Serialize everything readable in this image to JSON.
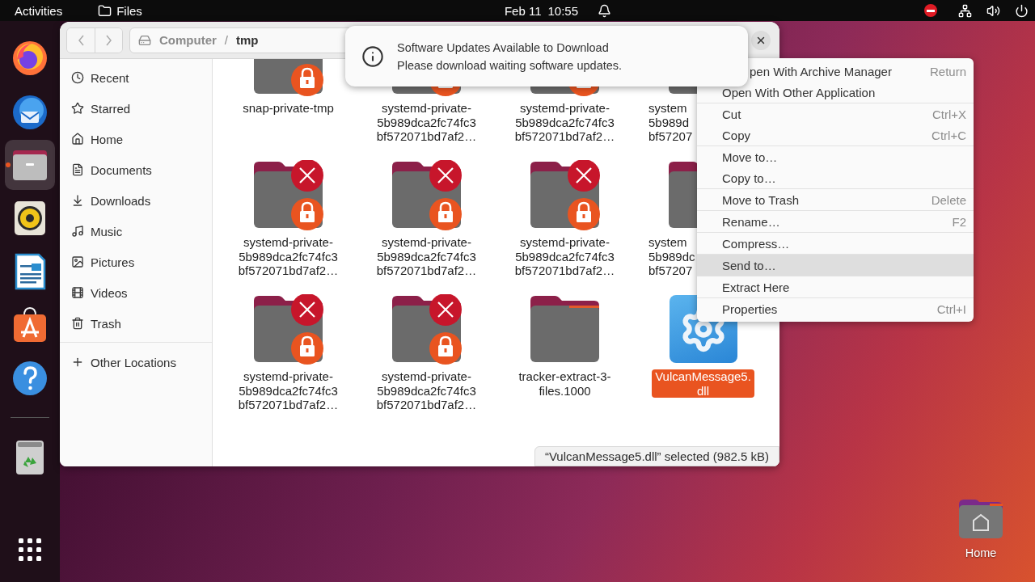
{
  "top_bar": {
    "activities": "Activities",
    "app_name": "Files",
    "date": "Feb 11",
    "time": "10:55"
  },
  "dock": {
    "apps": [
      {
        "kind": "firefox",
        "running": false
      },
      {
        "kind": "thunderbird",
        "running": false
      },
      {
        "kind": "files",
        "running": true
      },
      {
        "kind": "rhythmbox",
        "running": false
      },
      {
        "kind": "writer",
        "running": false
      },
      {
        "kind": "app-center",
        "running": false
      },
      {
        "kind": "help",
        "running": false
      }
    ]
  },
  "files_window": {
    "path": [
      {
        "label": "Computer",
        "current": false
      },
      {
        "label": "tmp",
        "current": true
      }
    ],
    "path_separator": "/",
    "sidebar": [
      {
        "label": "Recent",
        "selected": false
      },
      {
        "label": "Starred",
        "selected": false
      },
      {
        "label": "Home",
        "selected": false
      },
      {
        "label": "Documents",
        "selected": false
      },
      {
        "label": "Downloads",
        "selected": false
      },
      {
        "label": "Music",
        "selected": false
      },
      {
        "label": "Pictures",
        "selected": false
      },
      {
        "label": "Videos",
        "selected": false
      },
      {
        "label": "Trash",
        "selected": false
      }
    ],
    "other_locations": "Other Locations",
    "items": [
      {
        "kind": "folder",
        "lines": [
          "snap-private-tmp"
        ],
        "locked": true,
        "no_access": false,
        "cut_off": false,
        "selected": false
      },
      {
        "kind": "folder",
        "lines": [
          "systemd-private-",
          "5b989dca2fc74fc3",
          "bf572071bd7af2…"
        ],
        "locked": true,
        "cut_off": false,
        "selected": false
      },
      {
        "kind": "folder",
        "lines": [
          "systemd-private-",
          "5b989dca2fc74fc3",
          "bf572071bd7af2…"
        ],
        "locked": true,
        "cut_off": false,
        "selected": false
      },
      {
        "kind": "folder",
        "lines": [
          "system",
          "5b989d",
          "bf57207"
        ],
        "cut_off": true,
        "selected": false
      },
      {
        "kind": "folder",
        "lines": [
          "systemd-private-",
          "5b989dca2fc74fc3",
          "bf572071bd7af2…"
        ],
        "locked": true,
        "no_access": true,
        "cut_off": false,
        "selected": false
      },
      {
        "kind": "folder",
        "lines": [
          "systemd-private-",
          "5b989dca2fc74fc3",
          "bf572071bd7af2…"
        ],
        "locked": true,
        "no_access": true,
        "cut_off": false,
        "selected": false
      },
      {
        "kind": "folder",
        "lines": [
          "systemd-private-",
          "5b989dca2fc74fc3",
          "bf572071bd7af2…"
        ],
        "locked": true,
        "no_access": true,
        "cut_off": false,
        "selected": false
      },
      {
        "kind": "folder",
        "lines": [
          "system",
          "5b989dc",
          "bf57207"
        ],
        "cut_off": true,
        "selected": false
      },
      {
        "kind": "folder",
        "lines": [
          "systemd-private-",
          "5b989dca2fc74fc3",
          "bf572071bd7af2…"
        ],
        "locked": true,
        "no_access": true,
        "cut_off": false,
        "selected": false
      },
      {
        "kind": "folder",
        "lines": [
          "systemd-private-",
          "5b989dca2fc74fc3",
          "bf572071bd7af2…"
        ],
        "locked": true,
        "no_access": true,
        "cut_off": false,
        "selected": false
      },
      {
        "kind": "folder",
        "lines": [
          "tracker-extract-3-",
          "files.1000"
        ],
        "locked": false,
        "no_access": false,
        "cut_off": false,
        "selected": false
      },
      {
        "kind": "file",
        "lines": [
          "VulcanMessage5.",
          "dll"
        ],
        "locked": false,
        "no_access": false,
        "cut_off": false,
        "selected": true
      }
    ],
    "status": "“VulcanMessage5.dll” selected (982.5 kB)"
  },
  "notification": {
    "title": "Software Updates Available to Download",
    "body": "Please download waiting software updates."
  },
  "context_menu": {
    "groups": [
      [
        {
          "label": "pen With Archive Manager",
          "shortcut": "Return",
          "cut_off": true,
          "highlighted": false
        },
        {
          "label": "Open With Other Application",
          "cut_off": false,
          "highlighted": false
        }
      ],
      [
        {
          "label": "Cut",
          "shortcut": "Ctrl+X",
          "cut_off": false,
          "highlighted": false
        },
        {
          "label": "Copy",
          "shortcut": "Ctrl+C",
          "cut_off": false,
          "highlighted": false
        }
      ],
      [
        {
          "label": "Move to…",
          "cut_off": false,
          "highlighted": false
        },
        {
          "label": "Copy to…",
          "cut_off": false,
          "highlighted": false
        }
      ],
      [
        {
          "label": "Move to Trash",
          "shortcut": "Delete",
          "cut_off": false,
          "highlighted": false
        }
      ],
      [
        {
          "label": "Rename…",
          "shortcut": "F2",
          "cut_off": false,
          "highlighted": false
        }
      ],
      [
        {
          "label": "Compress…",
          "cut_off": false,
          "highlighted": false
        }
      ],
      [
        {
          "label": "Send to…",
          "cut_off": false,
          "highlighted": true
        }
      ],
      [
        {
          "label": "Extract Here",
          "cut_off": false,
          "highlighted": false
        }
      ],
      [
        {
          "label": "Properties",
          "shortcut": "Ctrl+I",
          "cut_off": false,
          "highlighted": false
        }
      ]
    ]
  },
  "desktop_icons": [
    {
      "label": "Home"
    }
  ]
}
